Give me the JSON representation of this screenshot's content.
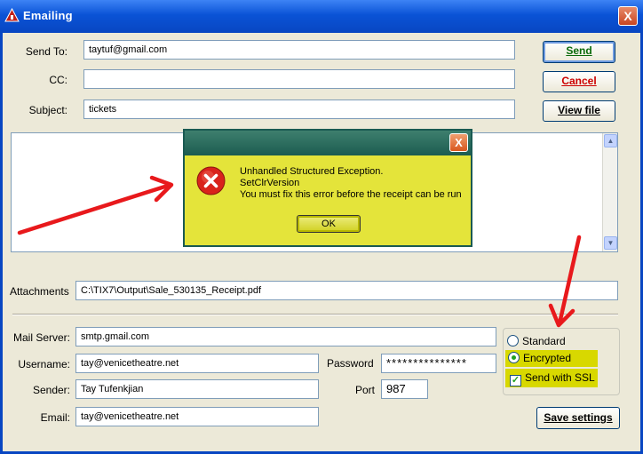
{
  "window": {
    "title": "Emailing",
    "close_glyph": "X"
  },
  "compose": {
    "send_to_label": "Send To:",
    "send_to_value": "taytuf@gmail.com",
    "cc_label": "CC:",
    "cc_value": "",
    "subject_label": "Subject:",
    "subject_value": "tickets",
    "attachments_label": "Attachments",
    "attachments_value": "C:\\TIX7\\Output\\Sale_530135_Receipt.pdf"
  },
  "buttons": {
    "send": "Send",
    "cancel": "Cancel",
    "view_file": "View file",
    "save_settings": "Save settings"
  },
  "server": {
    "mail_server_label": "Mail Server:",
    "mail_server_value": "smtp.gmail.com",
    "username_label": "Username:",
    "username_value": "tay@venicetheatre.net",
    "password_label": "Password",
    "password_value": "***************",
    "sender_label": "Sender:",
    "sender_value": "Tay Tufenkjian",
    "port_label": "Port",
    "port_value": "987",
    "email_label": "Email:",
    "email_value": "tay@venicetheatre.net"
  },
  "security": {
    "standard_label": "Standard",
    "encrypted_label": "Encrypted",
    "ssl_label": "Send with SSL",
    "selected": "Encrypted",
    "ssl_checked": true
  },
  "error_dialog": {
    "line1": "Unhandled Structured Exception.",
    "line2": "SetClrVersion",
    "line3": "You must fix this error before the receipt can be run",
    "ok_label": "OK",
    "close_glyph": "X",
    "icon": "error-icon"
  },
  "colors": {
    "highlight": "#d8d800",
    "annotation_arrow": "#e8191c",
    "titlebar": "#0a53d6"
  }
}
